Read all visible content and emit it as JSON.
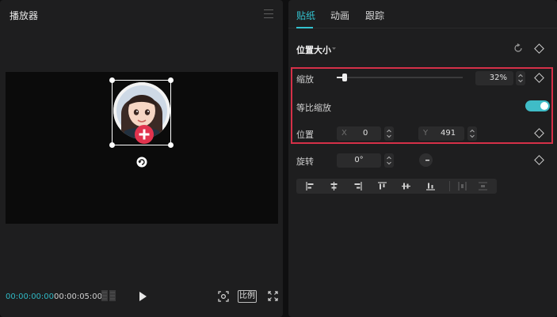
{
  "player": {
    "title": "播放器",
    "timecode_current": "00:00:00:00",
    "timecode_total": "00:00:05:00",
    "ratio_label": "比例"
  },
  "inspector": {
    "tabs": [
      {
        "label": "贴纸",
        "active": true
      },
      {
        "label": "动画",
        "active": false
      },
      {
        "label": "跟踪",
        "active": false
      }
    ],
    "section_title": "位置大小",
    "scale": {
      "label": "缩放",
      "value": "32%",
      "slider_fraction": 0.07
    },
    "uniform_scale": {
      "label": "等比缩放",
      "enabled": true
    },
    "position": {
      "label": "位置",
      "x_label": "X",
      "x_value": "0",
      "y_label": "Y",
      "y_value": "491"
    },
    "rotation": {
      "label": "旋转",
      "value": "0°"
    },
    "align_icons": [
      "align-left-icon",
      "align-center-h-icon",
      "align-right-icon",
      "align-top-icon",
      "align-center-v-icon",
      "align-bottom-icon",
      "distribute-h-icon",
      "distribute-v-icon"
    ]
  },
  "colors": {
    "accent": "#33c2cf",
    "highlight_border": "#d63048",
    "sticker_badge": "#e1334e"
  }
}
